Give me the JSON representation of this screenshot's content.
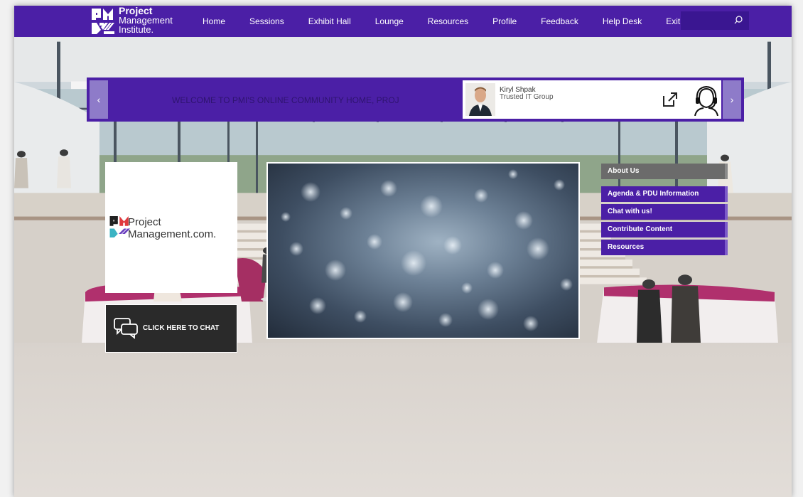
{
  "brand": {
    "logo_line1": "Project",
    "logo_line2": "Management",
    "logo_line3": "Institute.",
    "accent": "#4b1fa6"
  },
  "nav": {
    "items": [
      {
        "label": "Home"
      },
      {
        "label": "Sessions"
      },
      {
        "label": "Exhibit Hall"
      },
      {
        "label": "Lounge"
      },
      {
        "label": "Resources"
      },
      {
        "label": "Profile"
      },
      {
        "label": "Feedback"
      },
      {
        "label": "Help Desk"
      },
      {
        "label": "Exit"
      }
    ],
    "search_placeholder": "",
    "search_icon": "search-icon"
  },
  "banner": {
    "prev_icon": "‹",
    "next_icon": "›",
    "marquee_text": "WELCOME TO PMI'S ONLINE COMMUNITY HOME, PROJ",
    "sponsor": {
      "name": "Kiryl Shpak",
      "org": "Trusted IT Group",
      "link_icon": "external-link-icon",
      "agent_icon": "support-agent-icon"
    }
  },
  "promo": {
    "logo_text_line1": "Project",
    "logo_text_line2": "Management.com."
  },
  "chat": {
    "label": "CLICK HERE TO CHAT",
    "icon": "chat-bubbles-icon"
  },
  "side_menu": {
    "items": [
      {
        "label": "About Us",
        "style": "grey"
      },
      {
        "label": "Agenda & PDU Information",
        "style": "purple"
      },
      {
        "label": "Chat with us!",
        "style": "purple"
      },
      {
        "label": "Contribute Content",
        "style": "purple"
      },
      {
        "label": "Resources",
        "style": "purple"
      }
    ]
  }
}
